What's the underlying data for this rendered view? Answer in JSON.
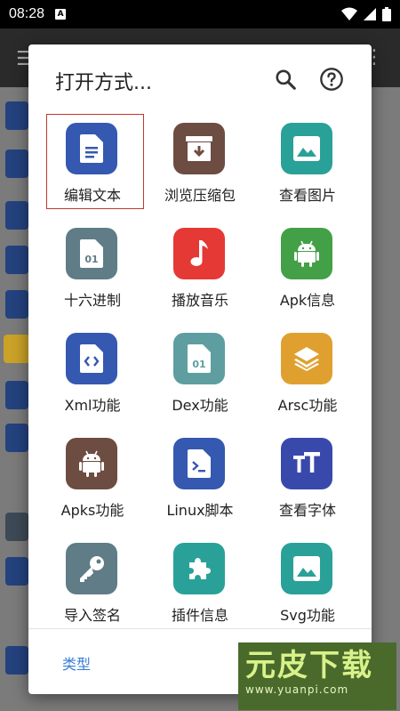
{
  "status_bar": {
    "time": "08:28",
    "notification_badge": "A"
  },
  "dialog": {
    "title": "打开方式...",
    "icons": {
      "search": "search-icon",
      "help": "help-icon"
    },
    "apps": [
      {
        "label": "编辑文本",
        "icon": "text-file-icon",
        "color": "#3558b0"
      },
      {
        "label": "浏览压缩包",
        "icon": "archive-icon",
        "color": "#6d4c41"
      },
      {
        "label": "查看图片",
        "icon": "image-icon",
        "color": "#2aa198"
      },
      {
        "label": "十六进制",
        "icon": "binary-file-icon",
        "color": "#5f7c87"
      },
      {
        "label": "播放音乐",
        "icon": "music-note-icon",
        "color": "#e53935"
      },
      {
        "label": "Apk信息",
        "icon": "android-icon",
        "color": "#43a047"
      },
      {
        "label": "Xml功能",
        "icon": "code-file-icon",
        "color": "#3558b0"
      },
      {
        "label": "Dex功能",
        "icon": "dex-file-icon",
        "color": "#5f9ea0"
      },
      {
        "label": "Arsc功能",
        "icon": "layers-icon",
        "color": "#e0a030"
      },
      {
        "label": "Apks功能",
        "icon": "android-icon",
        "color": "#6d4c41"
      },
      {
        "label": "Linux脚本",
        "icon": "terminal-file-icon",
        "color": "#3558b0"
      },
      {
        "label": "查看字体",
        "icon": "font-icon",
        "color": "#3949ab"
      },
      {
        "label": "导入签名",
        "icon": "key-icon",
        "color": "#5f7c87"
      },
      {
        "label": "插件信息",
        "icon": "puzzle-icon",
        "color": "#2aa198"
      },
      {
        "label": "Svg功能",
        "icon": "image-icon",
        "color": "#2aa198"
      }
    ],
    "selected_index": 0,
    "type_button": "类型"
  },
  "watermark": {
    "title": "元皮下载",
    "url": "www.yuanpi.com"
  }
}
